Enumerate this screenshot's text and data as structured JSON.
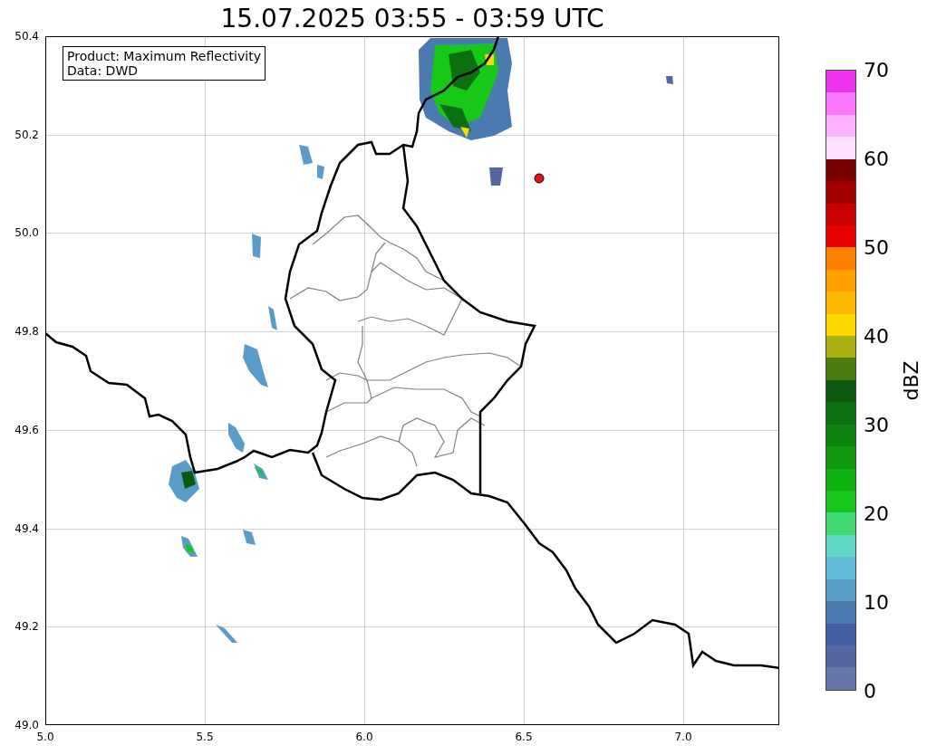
{
  "title": "15.07.2025 03:55 - 03:59 UTC",
  "legend_lines": [
    "Product: Maximum Reflectivity",
    "Data: DWD"
  ],
  "x_ticks": [
    "5.0",
    "5.5",
    "6.0",
    "6.5",
    "7.0"
  ],
  "y_ticks": [
    "50.4",
    "50.2",
    "50.0",
    "49.8",
    "49.6",
    "49.4",
    "49.2",
    "49.0"
  ],
  "colorbar": {
    "label": "dBZ",
    "ticks": [
      "70",
      "60",
      "50",
      "40",
      "30",
      "20",
      "10",
      "0"
    ],
    "segments": [
      {
        "color": "#6677aa"
      },
      {
        "color": "#5566a0"
      },
      {
        "color": "#4460a0"
      },
      {
        "color": "#4a7ab0"
      },
      {
        "color": "#5a9cc8"
      },
      {
        "color": "#60bcd8"
      },
      {
        "color": "#60d8c8"
      },
      {
        "color": "#40d870"
      },
      {
        "color": "#18c818"
      },
      {
        "color": "#10b010"
      },
      {
        "color": "#109a10"
      },
      {
        "color": "#0e8410"
      },
      {
        "color": "#0c7010"
      },
      {
        "color": "#0a5a10"
      },
      {
        "color": "#4a7a10"
      },
      {
        "color": "#a8b010"
      },
      {
        "color": "#ffd800"
      },
      {
        "color": "#ffb800"
      },
      {
        "color": "#ffa000"
      },
      {
        "color": "#ff8000"
      },
      {
        "color": "#e80000"
      },
      {
        "color": "#c80000"
      },
      {
        "color": "#a00000"
      },
      {
        "color": "#780000"
      },
      {
        "color": "#ffe0ff"
      },
      {
        "color": "#ffb0ff"
      },
      {
        "color": "#ff78ff"
      },
      {
        "color": "#ee33ee"
      }
    ]
  }
}
